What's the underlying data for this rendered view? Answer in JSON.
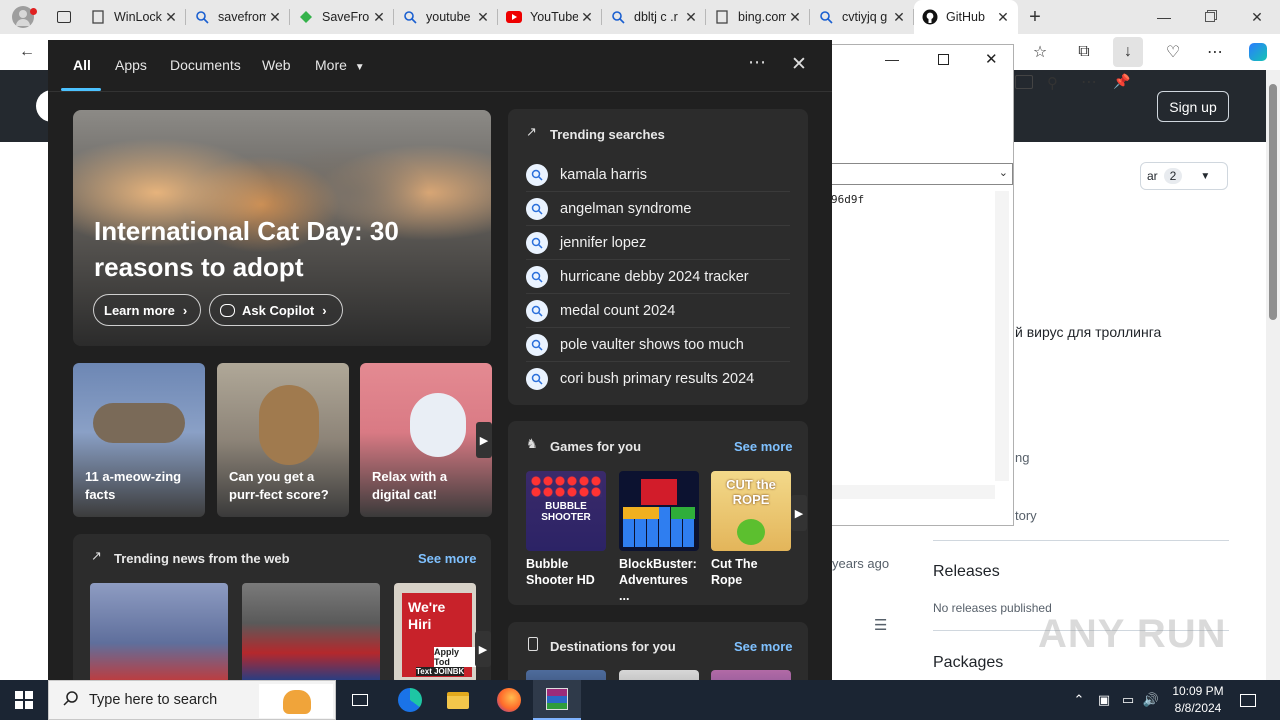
{
  "browser": {
    "tabs": [
      {
        "label": "WinLocker",
        "icon": "document-icon"
      },
      {
        "label": "savefrom",
        "icon": "search-icon"
      },
      {
        "label": "SaveFrom",
        "icon": "savefrom-icon"
      },
      {
        "label": "youtube",
        "icon": "search-icon"
      },
      {
        "label": "YouTube",
        "icon": "youtube-icon"
      },
      {
        "label": "dbltj c .r",
        "icon": "search-icon"
      },
      {
        "label": "bing.com",
        "icon": "document-icon"
      },
      {
        "label": "cvtiyjq g",
        "icon": "search-icon"
      },
      {
        "label": "GitHub",
        "icon": "github-icon",
        "active": true
      }
    ]
  },
  "github": {
    "signup_label": "Sign up",
    "star_count": "2",
    "star_label_partial": "ar",
    "description_partial": "й вирус для троллинга",
    "commit_hash_partial": "96d9f",
    "years_ago": "years ago",
    "sidebar_partial_1": "ng",
    "sidebar_partial_2": "tory",
    "releases_heading": "Releases",
    "releases_text": "No releases published",
    "packages_heading": "Packages"
  },
  "flyout": {
    "tabs": [
      "All",
      "Apps",
      "Documents",
      "Web",
      "More"
    ],
    "hero": {
      "title": "International Cat Day: 30 reasons to adopt",
      "learn_more": "Learn more",
      "ask_copilot": "Ask Copilot"
    },
    "tiles": [
      {
        "text": "11 a-meow-zing facts"
      },
      {
        "text": "Can you get a purr-fect score?"
      },
      {
        "text": "Relax with a digital cat!"
      }
    ],
    "trending_news": {
      "title": "Trending news from the web",
      "see_more": "See more",
      "thumb3_caption": "We're Hiri",
      "thumb3_sub": "Apply Tod",
      "thumb3_ad": "Text JOINBK"
    },
    "trending_searches": {
      "title": "Trending searches",
      "items": [
        "kamala harris",
        "angelman syndrome",
        "jennifer lopez",
        "hurricane debby 2024 tracker",
        "medal count 2024",
        "pole vaulter shows too much",
        "cori bush primary results 2024"
      ]
    },
    "games": {
      "title": "Games for you",
      "see_more": "See more",
      "items": [
        {
          "name": "Bubble Shooter HD",
          "logo_text": "BUBBLE SHOOTER"
        },
        {
          "name": "BlockBuster: Adventures ...",
          "logo_text": ""
        },
        {
          "name": "Cut The Rope",
          "logo_text": "CUT the ROPE"
        }
      ]
    },
    "destinations": {
      "title": "Destinations for you",
      "see_more": "See more"
    }
  },
  "taskbar": {
    "search_placeholder": "Type here to search",
    "time": "10:09 PM",
    "date": "8/8/2024"
  },
  "watermark": "ANY RUN",
  "colors": {
    "flyout_bg": "#202020",
    "card_bg": "#2c2c2c",
    "accent": "#4cc2ff",
    "link": "#7fc1ff",
    "taskbar": "#1b2533"
  }
}
